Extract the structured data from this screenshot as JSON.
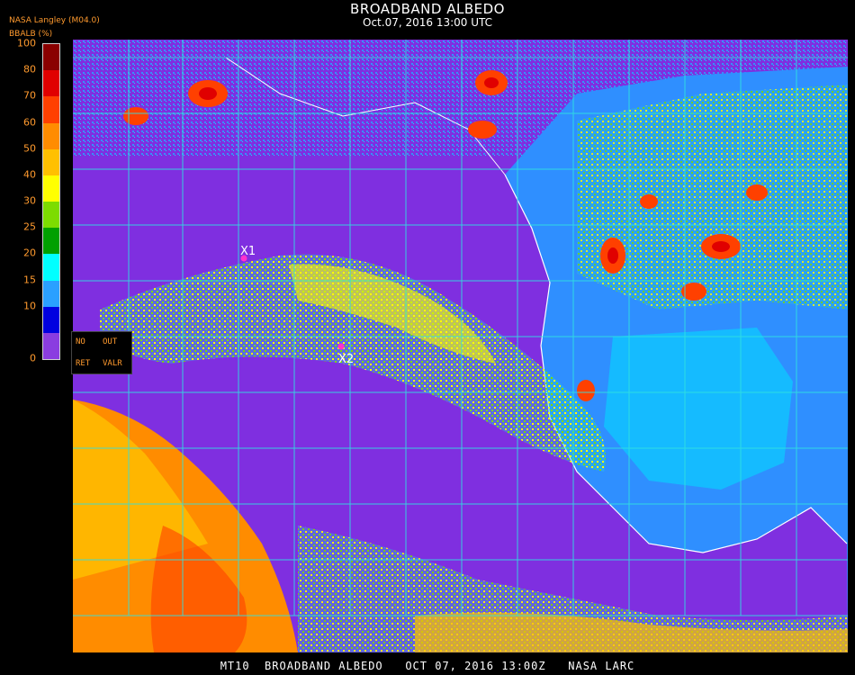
{
  "header": {
    "title": "BROADBAND ALBEDO",
    "subtitle": "Oct.07, 2016 13:00 UTC",
    "source_label": "NASA Langley (M04.0)",
    "param_label": "BBALB (%)"
  },
  "colorbar": {
    "ticks": [
      "100",
      "80",
      "70",
      "60",
      "50",
      "40",
      "30",
      "25",
      "20",
      "15",
      "10",
      "0"
    ],
    "colors": [
      "#8a0000",
      "#e00000",
      "#ff4000",
      "#ff8c00",
      "#ffc000",
      "#ffff00",
      "#7ddc00",
      "#00a000",
      "#00ffff",
      "#2aa0ff",
      "#0000e0",
      "#8a3de0"
    ]
  },
  "legend_box": {
    "no": "NO",
    "out": "OUT",
    "ret": "RET",
    "valr": "VALR"
  },
  "markers": [
    {
      "label": "X1",
      "color": "#ff33cc"
    },
    {
      "label": "X2",
      "color": "#ff33cc"
    }
  ],
  "colors": {
    "clear_ocean": "#7f2fe0",
    "land": "#2f8fff",
    "grid": "#30e0e0",
    "coast": "#ffffff"
  },
  "footer": "MT10  BROADBAND ALBEDO   OCT 07, 2016 13:00Z   NASA LARC"
}
